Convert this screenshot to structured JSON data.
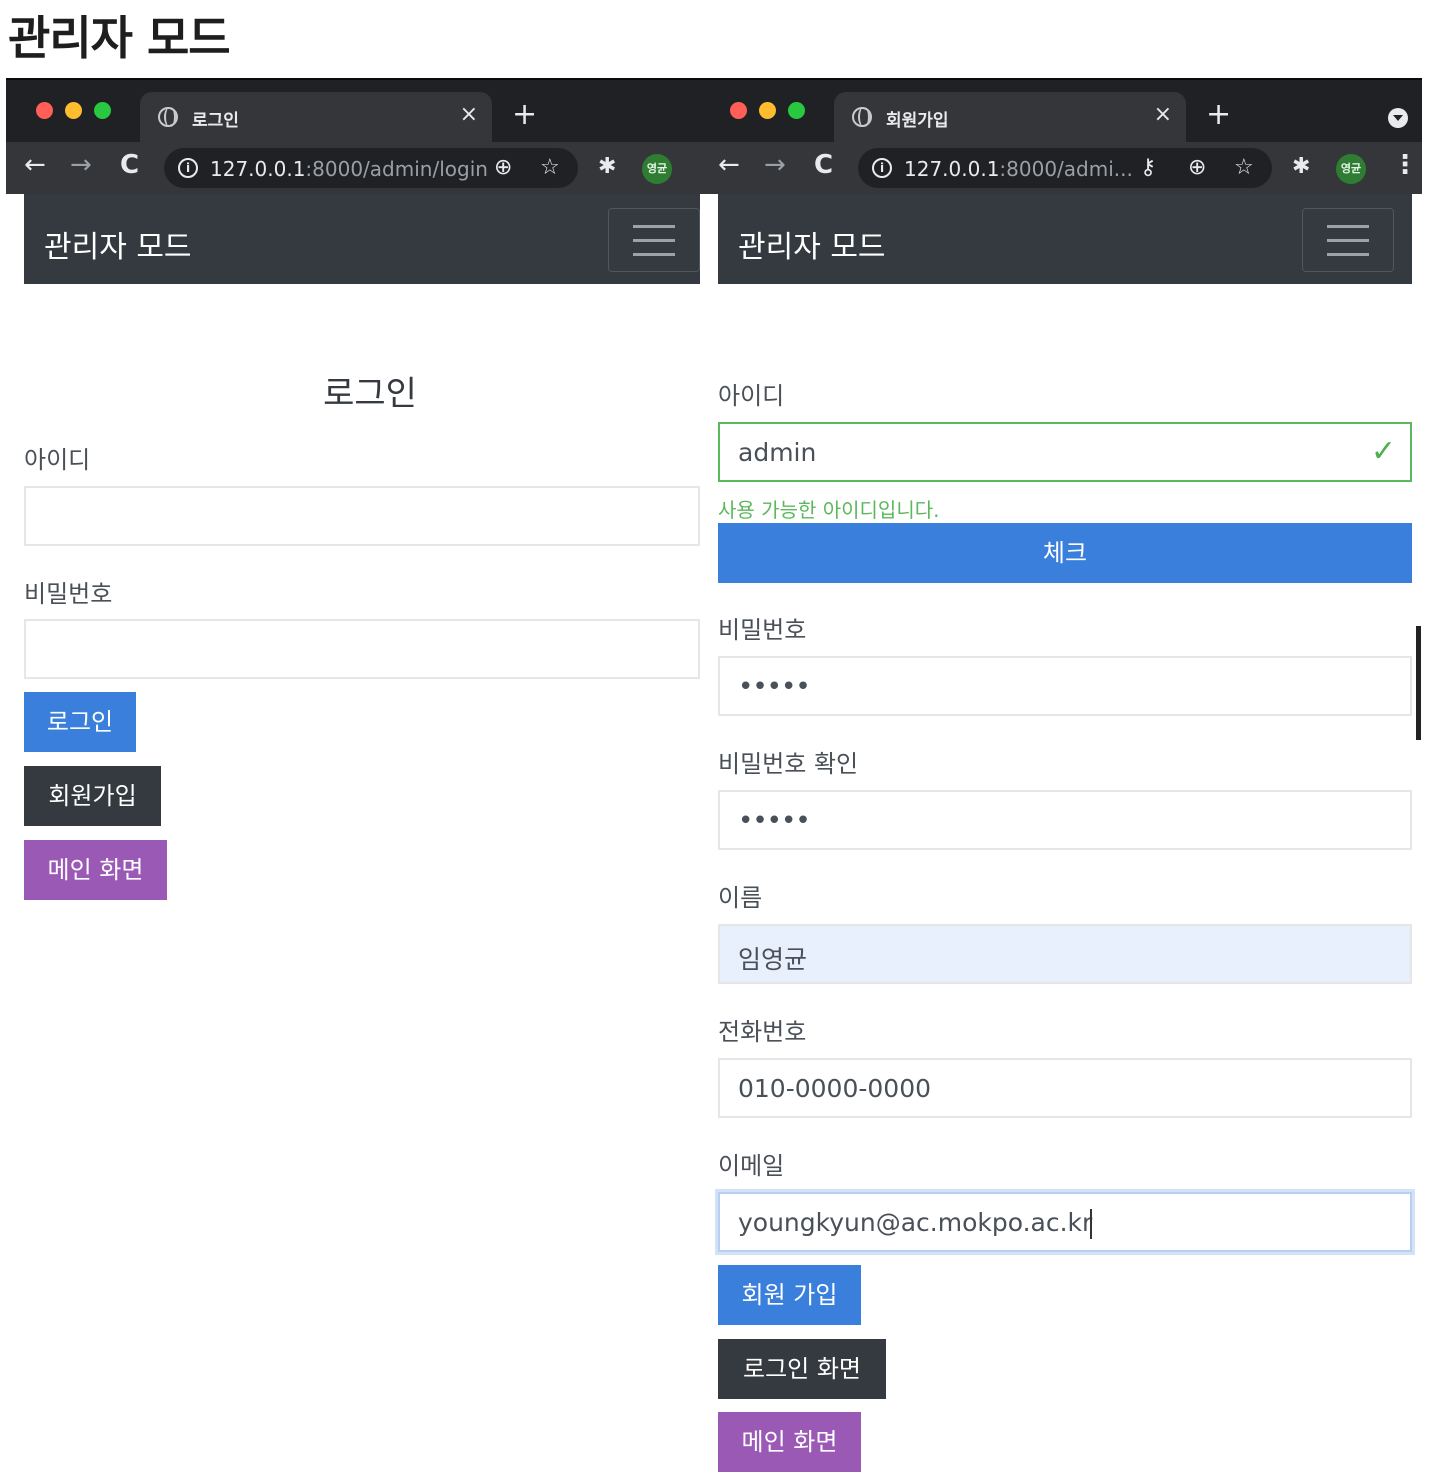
{
  "page_title": "관리자 모드",
  "login_window": {
    "tab_title": "로그인",
    "url_host": "127.0.0.1",
    "url_path": ":8000/admin/login",
    "avatar": "영균",
    "navbar_brand": "관리자 모드",
    "heading": "로그인",
    "id_label": "아이디",
    "id_value": "",
    "password_label": "비밀번호",
    "password_value": "",
    "login_button": "로그인",
    "signup_button": "회원가입",
    "main_button": "메인 화면"
  },
  "signup_window": {
    "tab_title": "회원가입",
    "url_host": "127.0.0.1",
    "url_path": ":8000/admi...",
    "avatar": "영균",
    "navbar_brand": "관리자 모드",
    "id_label": "아이디",
    "id_value": "admin",
    "id_valid_message": "사용 가능한 아이디입니다.",
    "check_button": "체크",
    "password_label": "비밀번호",
    "password_value": "•••••",
    "password_confirm_label": "비밀번호 확인",
    "password_confirm_value": "•••••",
    "name_label": "이름",
    "name_value": "임영균",
    "phone_label": "전화번호",
    "phone_value": "010-0000-0000",
    "email_label": "이메일",
    "email_value": "youngkyun@ac.mokpo.ac.kr",
    "signup_button": "회원 가입",
    "login_screen_button": "로그인 화면",
    "main_button": "메인 화면"
  },
  "icons": {
    "back": "←",
    "forward": "→",
    "reload": "C",
    "close": "×",
    "new_tab": "+",
    "zoom": "⊕",
    "star": "☆",
    "extension": "✱",
    "key": "⚷",
    "menu": "⋮",
    "check": "✓",
    "info": "i"
  },
  "colors": {
    "primary": "#3a7fdb",
    "dark": "#343a40",
    "purple": "#9b59b6",
    "valid": "#5cb85c",
    "browser_frame": "#202124"
  }
}
